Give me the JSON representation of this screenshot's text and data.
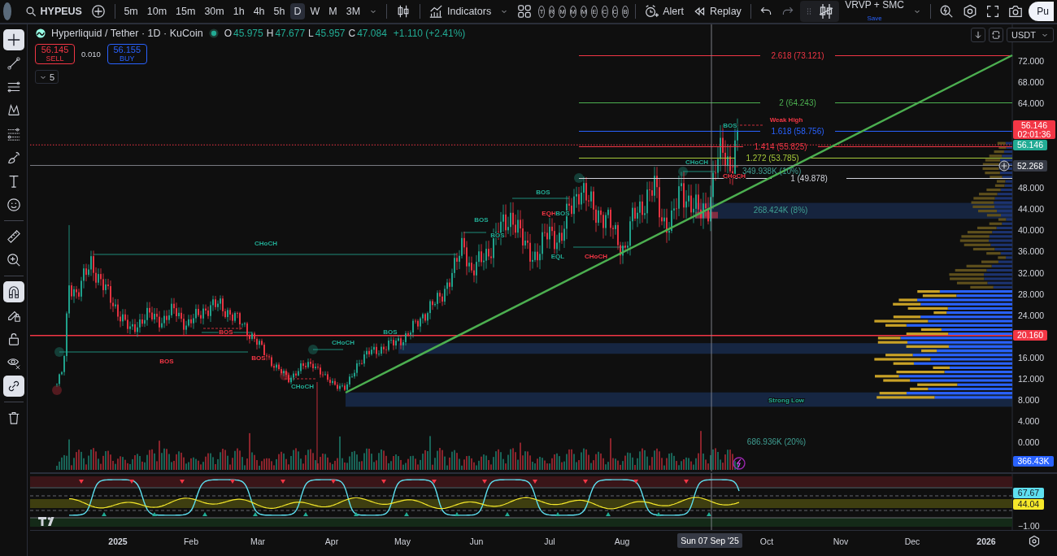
{
  "toolbar": {
    "symbol": "HYPEUS",
    "intervals": [
      {
        "label": "5m",
        "selected": false
      },
      {
        "label": "10m",
        "selected": false
      },
      {
        "label": "15m",
        "selected": false
      },
      {
        "label": "30m",
        "selected": false
      },
      {
        "label": "1h",
        "selected": false
      },
      {
        "label": "4h",
        "selected": false
      },
      {
        "label": "5h",
        "selected": false
      },
      {
        "label": "D",
        "selected": true
      },
      {
        "label": "W",
        "selected": false
      },
      {
        "label": "M",
        "selected": false
      },
      {
        "label": "3M",
        "selected": false
      }
    ],
    "indicators_label": "Indicators",
    "study_buttons": [
      "T",
      "R",
      "M",
      "M",
      "M",
      "E",
      "C",
      "C",
      "B"
    ],
    "alert_label": "Alert",
    "replay_label": "Replay",
    "layout": {
      "name": "VRVP + SMC",
      "status": "Save"
    },
    "publish_label": "Pu"
  },
  "drawing_tools": [
    {
      "selected": true
    },
    {
      "selected": false
    },
    {
      "selected": false
    },
    {
      "selected": false
    },
    {
      "selected": false
    },
    {
      "selected": false
    },
    {
      "selected": false
    },
    {
      "selected": false
    },
    {
      "selected": false
    },
    {
      "selected": false
    },
    {
      "selected": true
    },
    {
      "selected": false
    },
    {
      "selected": false
    },
    {
      "selected": false
    },
    {
      "selected": true
    },
    {
      "selected": false
    }
  ],
  "legend": {
    "title": "Hyperliquid / Tether · 1D · KuCoin",
    "values": [
      {
        "label": "O",
        "value": "45.975"
      },
      {
        "label": "H",
        "value": "47.677"
      },
      {
        "label": "L",
        "value": "45.957"
      },
      {
        "label": "C",
        "value": "47.084"
      }
    ],
    "change": "+1.110 (+2.41%)"
  },
  "order": {
    "sell_price": "56.145",
    "sell_label": "SELL",
    "spread": "0.010",
    "buy_price": "56.155",
    "buy_label": "BUY"
  },
  "indicator_count": "5",
  "currency": "USDT",
  "fib_levels": [
    {
      "label": "2.618 (73.121)",
      "color": "#f23645"
    },
    {
      "label": "2 (64.243)",
      "color": "#4caf50"
    },
    {
      "label": "1.618 (58.756)",
      "color": "#2962ff"
    },
    {
      "label": "1.414 (55.825)",
      "color": "#f23645"
    },
    {
      "label": "1.272 (53.785)",
      "color": "#a6c93a"
    },
    {
      "label": "1 (49.878)",
      "color": "#d1d4dc"
    }
  ],
  "structure_labels": [
    {
      "text": "CHoCH",
      "color": "#22ab94"
    },
    {
      "text": "BOS",
      "color": "#f23645"
    },
    {
      "text": "BOS",
      "color": "#f23645"
    },
    {
      "text": "BOS",
      "color": "#f23645"
    },
    {
      "text": "CHoCH",
      "color": "#22ab94"
    },
    {
      "text": "BOS",
      "color": "#22ab94"
    },
    {
      "text": "BOS",
      "color": "#22ab94"
    },
    {
      "text": "BOS",
      "color": "#22ab94"
    },
    {
      "text": "BOS",
      "color": "#22ab94"
    },
    {
      "text": "EQH",
      "color": "#f23645"
    },
    {
      "text": "BOS",
      "color": "#22ab94"
    },
    {
      "text": "EQL",
      "color": "#22ab94"
    },
    {
      "text": "CHoCH",
      "color": "#f23645"
    },
    {
      "text": "CHoCH",
      "color": "#22ab94"
    },
    {
      "text": "CHoCH",
      "color": "#f23645"
    },
    {
      "text": "BOS",
      "color": "#22ab94"
    },
    {
      "text": "Weak High",
      "color": "#f23645"
    },
    {
      "text": "Strong Low",
      "color": "#22ab94"
    },
    {
      "text": "CHoCH",
      "color": "#22ab94"
    }
  ],
  "volume_labels": [
    "349.938K (10%)",
    "268.424K (8%)",
    "686.936K (20%)"
  ],
  "price_axis": {
    "ticks": [
      "72.000",
      "68.000",
      "64.000",
      "48.000",
      "44.000",
      "40.000",
      "36.000",
      "32.000",
      "28.000",
      "24.000",
      "16.000",
      "12.000",
      "8.000",
      "4.000",
      "0.000"
    ],
    "last_price": "56.146",
    "countdown": "02:01:36",
    "bid_price": "56.146",
    "crosshair_price": "52.268",
    "line_price": "20.160",
    "volume": "366.43K"
  },
  "oscillator_axis": {
    "cyan_value": "67.67",
    "yellow_value": "44.04",
    "bottom_tick": "−1.00"
  },
  "time_axis": {
    "labels": [
      "2025",
      "Feb",
      "Mar",
      "Apr",
      "May",
      "Jun",
      "Jul",
      "Aug",
      "Oct",
      "Nov",
      "Dec",
      "2026"
    ],
    "crosshair_date": "Sun 07 Sep '25"
  }
}
